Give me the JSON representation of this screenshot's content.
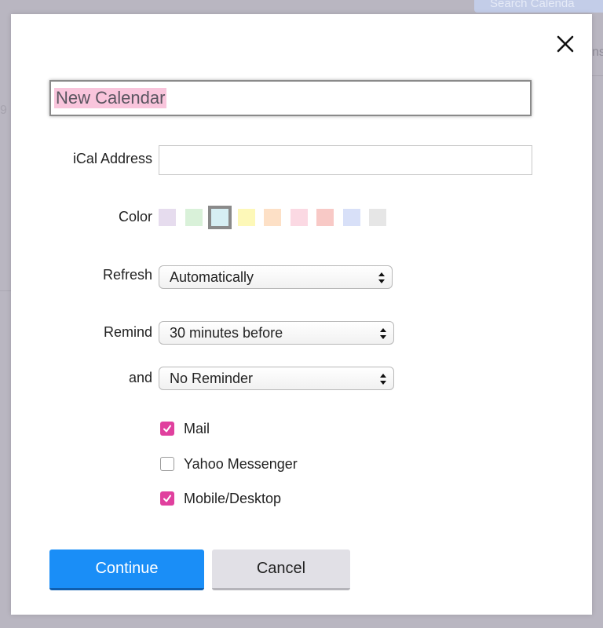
{
  "background": {
    "top_button_text": "Search Calenda",
    "right_text": "ns",
    "left_text": "9"
  },
  "dialog": {
    "close_icon": "close-x-icon",
    "calendar_name": "New Calendar",
    "ical": {
      "label": "iCal Address",
      "value": ""
    },
    "color": {
      "label": "Color",
      "swatches": [
        "#e6dcee",
        "#d9f1d9",
        "#d6eef3",
        "#fdf8b8",
        "#fde0c6",
        "#fbd9e3",
        "#f8c9c6",
        "#d8e0f8",
        "#e6e6e6"
      ],
      "selected_index": 2
    },
    "refresh": {
      "label": "Refresh",
      "selected": "Automatically"
    },
    "remind": {
      "label": "Remind",
      "selected": "30 minutes before"
    },
    "and": {
      "label": "and",
      "selected": "No Reminder"
    },
    "notify": [
      {
        "label": "Mail",
        "checked": true
      },
      {
        "label": "Yahoo Messenger",
        "checked": false
      },
      {
        "label": "Mobile/Desktop",
        "checked": true
      }
    ],
    "buttons": {
      "continue": "Continue",
      "cancel": "Cancel"
    }
  },
  "colors": {
    "accent": "#1a8ef7",
    "check": "#e0409e",
    "highlight": "#f9c5dc"
  }
}
